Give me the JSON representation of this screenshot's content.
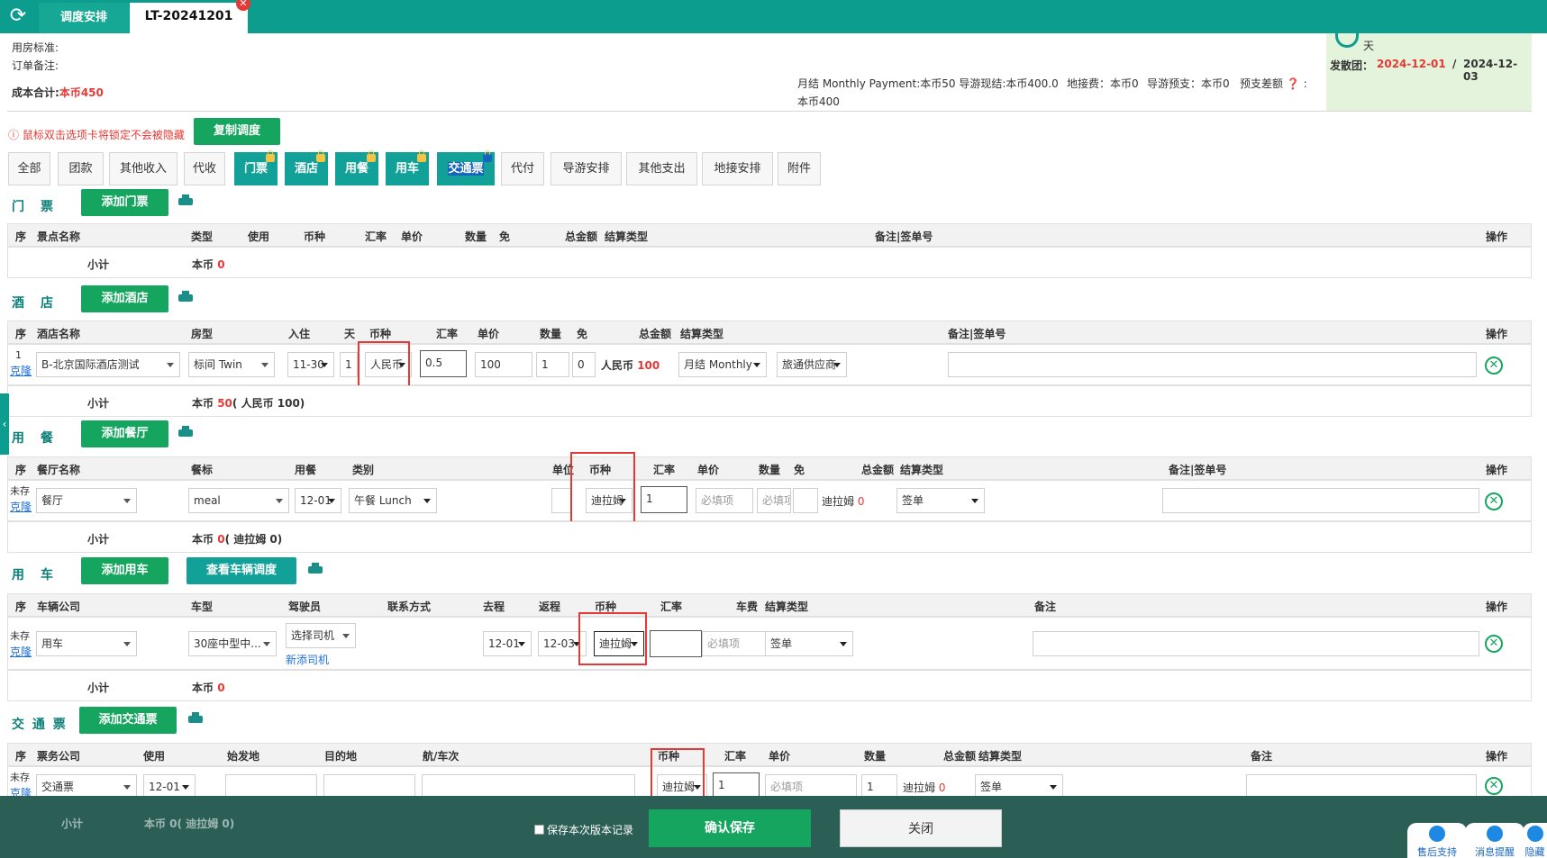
{
  "tabs": {
    "refresh_icon": "refresh-icon",
    "tab1": "调度安排",
    "tab2": "LT-20241201"
  },
  "info": {
    "room_std": "用房标准:",
    "order_note": "订单备注:",
    "cost_total_label": "成本合计:",
    "cost_total_value": "本币450",
    "payment_line": "月结 Monthly Payment:本币50 导游现结:本币400.0",
    "payment_line2": "本币400",
    "ground_fee": "地接费：本币0",
    "guide_prepay": "导游预支：本币0",
    "prepay_diff": "预支差额",
    "days_unit": "天",
    "depart_label": "发散团：",
    "depart_date": "2024-12-01",
    "date_sep": "/",
    "end_date": "2024-12-03"
  },
  "hint": {
    "text": "鼠标双击选项卡将锁定不会被隐藏",
    "copy_btn": "复制调度"
  },
  "filters": [
    "全部",
    "团款",
    "其他收入",
    "代收",
    "门票",
    "酒店",
    "用餐",
    "用车",
    "交通票",
    "代付",
    "导游安排",
    "其他支出",
    "地接安排",
    "附件"
  ],
  "tickets": {
    "title": "门　票",
    "add_btn": "添加门票",
    "headers": [
      "序",
      "景点名称",
      "类型",
      "使用",
      "币种",
      "汇率",
      "单价",
      "数量",
      "免",
      "总金额",
      "结算类型",
      "备注|签单号",
      "操作"
    ],
    "subtotal_label": "小计",
    "subtotal_prefix": "本币",
    "subtotal_value": "0"
  },
  "hotel": {
    "title": "酒　店",
    "add_btn": "添加酒店",
    "headers": [
      "序",
      "酒店名称",
      "房型",
      "入住",
      "天",
      "币种",
      "汇率",
      "单价",
      "数量",
      "免",
      "总金额",
      "结算类型",
      "备注|签单号",
      "操作"
    ],
    "row": {
      "seq": "1",
      "clone": "克隆",
      "name": "B-北京国际酒店测试",
      "room": "标间 Twin",
      "checkin": "11-30",
      "days": "1",
      "currency": "人民币",
      "rate": "0.5",
      "price": "100",
      "qty": "1",
      "free": "0",
      "total_prefix": "人民币",
      "total": "100",
      "settle": "月结 Monthly",
      "supplier": "旅通供应商"
    },
    "subtotal_label": "小计",
    "subtotal_prefix": "本币",
    "subtotal_value": "50",
    "subtotal_extra": "( 人民币 100)"
  },
  "meal": {
    "title": "用　餐",
    "add_btn": "添加餐厅",
    "headers": [
      "序",
      "餐厅名称",
      "餐标",
      "用餐",
      "类别",
      "单位",
      "币种",
      "汇率",
      "单价",
      "数量",
      "免",
      "总金额",
      "结算类型",
      "备注|签单号",
      "操作"
    ],
    "row": {
      "seq": "未存",
      "clone": "克隆",
      "name": "餐厅",
      "std": "meal",
      "date": "12-01",
      "type": "午餐 Lunch",
      "currency": "迪拉姆",
      "rate": "1",
      "price_ph": "必填项",
      "qty_ph": "必填项",
      "total_prefix": "迪拉姆",
      "total": "0",
      "settle": "签单"
    },
    "subtotal_label": "小计",
    "subtotal_prefix": "本币",
    "subtotal_value": "0",
    "subtotal_extra": "( 迪拉姆 0)"
  },
  "car": {
    "title": "用　车",
    "add_btn": "添加用车",
    "view_btn": "查看车辆调度",
    "headers": [
      "序",
      "车辆公司",
      "车型",
      "驾驶员",
      "联系方式",
      "去程",
      "返程",
      "币种",
      "汇率",
      "车费",
      "结算类型",
      "备注",
      "操作"
    ],
    "row": {
      "seq": "未存",
      "clone": "克隆",
      "company": "用车",
      "model": "30座中型中...",
      "driver": "选择司机",
      "new_driver": "新添司机",
      "go": "12-01",
      "back": "12-03",
      "currency": "迪拉姆",
      "fee_ph": "必填项",
      "settle": "签单"
    },
    "subtotal_label": "小计",
    "subtotal_prefix": "本币",
    "subtotal_value": "0"
  },
  "transport": {
    "title": "交 通 票",
    "add_btn": "添加交通票",
    "headers": [
      "序",
      "票务公司",
      "使用",
      "始发地",
      "目的地",
      "航/车次",
      "币种",
      "汇率",
      "单价",
      "数量",
      "总金额",
      "结算类型",
      "备注",
      "操作"
    ],
    "row": {
      "seq": "未存",
      "clone": "克隆",
      "company": "交通票",
      "date": "12-01",
      "currency": "迪拉姆",
      "rate": "1",
      "price_ph": "必填项",
      "qty": "1",
      "total_prefix": "迪拉姆",
      "total": "0",
      "settle": "签单"
    },
    "subtotal_label": "小计",
    "subtotal_text": "本币 0( 迪拉姆 0)"
  },
  "footer": {
    "save_version": "保存本次版本记录",
    "confirm": "确认保存",
    "close": "关闭",
    "support": "售后支持",
    "messages": "消息提醒",
    "hide": "隐藏"
  },
  "colors": {
    "topbar": "#0c9d8e",
    "green_btn": "#16a55f",
    "teal_btn": "#12a198",
    "accent_red": "#e53935"
  }
}
